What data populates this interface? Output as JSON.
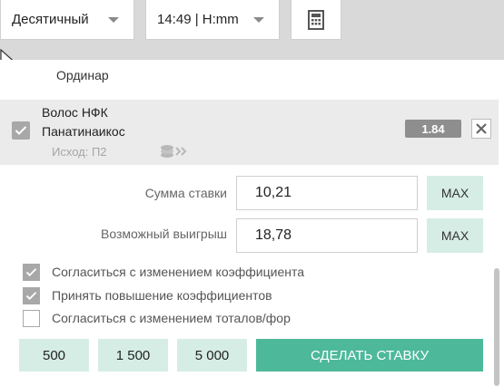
{
  "toolbar": {
    "odds_format": "Десятичный",
    "time_format": "14:49 | H:mm",
    "calculator_icon": "calculator-icon"
  },
  "coupon": {
    "title": "Ординар",
    "bet": {
      "team1": "Волос НФК",
      "team2": "Панатинаикос",
      "outcome": "Исход: П2",
      "coefficient": "1.84",
      "selected": true
    },
    "stake_label": "Сумма ставки",
    "stake_value": "10,21",
    "potential_win_label": "Возможный выигрыш",
    "potential_win_value": "18,78",
    "max_label": "MAX",
    "options": [
      {
        "label": "Согласиться с изменением коэффициента",
        "checked": true
      },
      {
        "label": "Принять повышение коэффициентов",
        "checked": true
      },
      {
        "label": "Согласиться с изменением тоталов/фор",
        "checked": false
      }
    ],
    "quick_amounts": [
      "500",
      "1 500",
      "5 000"
    ],
    "place_bet_label": "СДЕЛАТЬ СТАВКУ"
  },
  "colors": {
    "accent": "#4db99a",
    "light_accent": "#d6ede6",
    "badge": "#8e8e8e"
  }
}
